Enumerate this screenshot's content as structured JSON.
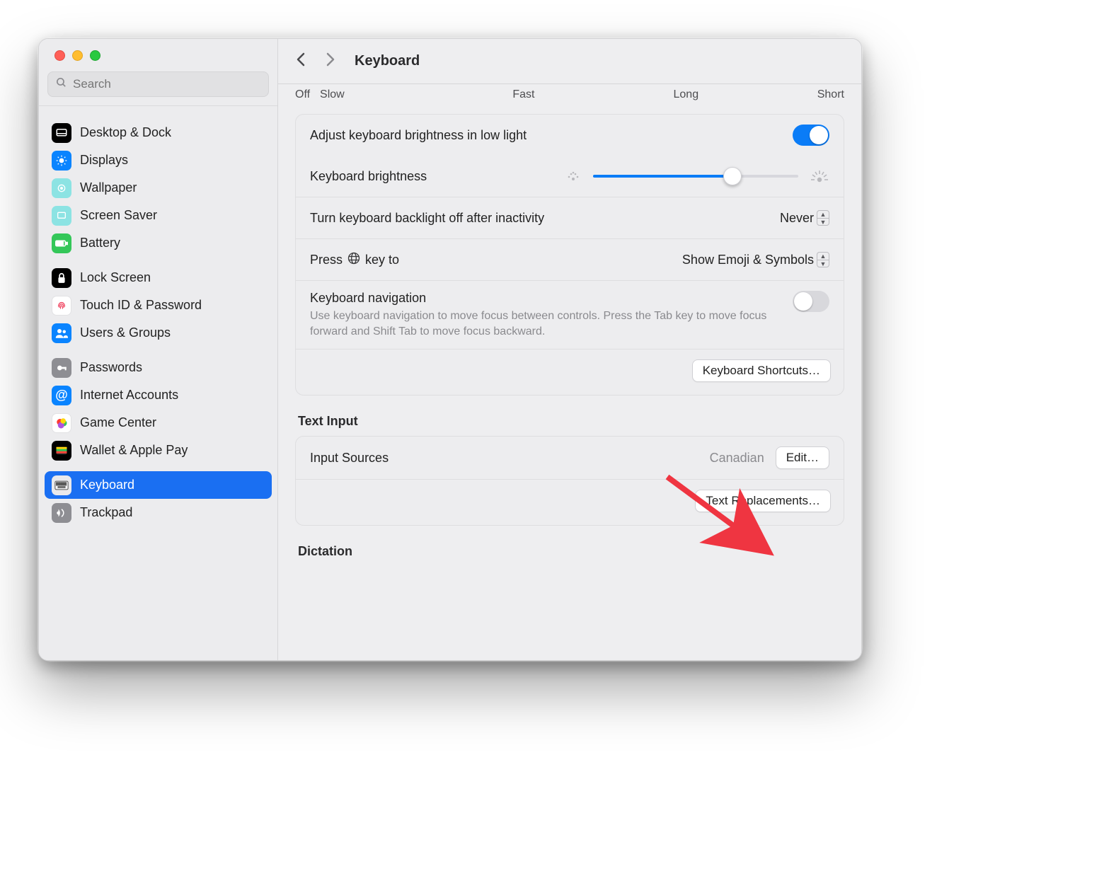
{
  "window_title": "Keyboard",
  "search": {
    "placeholder": "Search"
  },
  "sidebar": {
    "items": [
      {
        "id": "desktop-dock",
        "label": "Desktop & Dock"
      },
      {
        "id": "displays",
        "label": "Displays"
      },
      {
        "id": "wallpaper",
        "label": "Wallpaper"
      },
      {
        "id": "screen-saver",
        "label": "Screen Saver"
      },
      {
        "id": "battery",
        "label": "Battery"
      },
      {
        "id": "lock-screen",
        "label": "Lock Screen"
      },
      {
        "id": "touch-id",
        "label": "Touch ID & Password"
      },
      {
        "id": "users-groups",
        "label": "Users & Groups"
      },
      {
        "id": "passwords",
        "label": "Passwords"
      },
      {
        "id": "internet-accounts",
        "label": "Internet Accounts"
      },
      {
        "id": "game-center",
        "label": "Game Center"
      },
      {
        "id": "wallet",
        "label": "Wallet & Apple Pay"
      },
      {
        "id": "keyboard",
        "label": "Keyboard",
        "selected": true
      },
      {
        "id": "trackpad",
        "label": "Trackpad"
      }
    ]
  },
  "ticks": {
    "off": "Off",
    "slow": "Slow",
    "fast": "Fast",
    "long": "Long",
    "short": "Short"
  },
  "settings": {
    "adjust_low_light": {
      "label": "Adjust keyboard brightness in low light",
      "on": true
    },
    "brightness": {
      "label": "Keyboard brightness",
      "value_pct": 68
    },
    "backlight_off": {
      "label": "Turn keyboard backlight off after inactivity",
      "value": "Never"
    },
    "press_globe": {
      "label_prefix": "Press ",
      "label_suffix": " key to",
      "value": "Show Emoji & Symbols"
    },
    "kbd_nav": {
      "label": "Keyboard navigation",
      "desc": "Use keyboard navigation to move focus between controls. Press the Tab key to move focus forward and Shift Tab to move focus backward.",
      "on": false
    },
    "shortcuts_btn": "Keyboard Shortcuts…"
  },
  "text_input": {
    "heading": "Text Input",
    "input_sources_label": "Input Sources",
    "input_sources_value": "Canadian",
    "edit_btn": "Edit…",
    "text_replacements_btn": "Text Replacements…"
  },
  "dictation": {
    "heading": "Dictation"
  },
  "icons": {
    "desktop-dock": "#000000",
    "displays": "#0a84ff",
    "wallpaper": "#5ed1d1",
    "screen-saver": "#5ed1d1",
    "battery": "#34c759",
    "lock-screen": "#000000",
    "touch-id": "#ffffff",
    "users-groups": "#0a84ff",
    "passwords": "#8e8e93",
    "internet-accounts": "#0a84ff",
    "game-center": "#ffffff",
    "wallet": "#000000",
    "keyboard": "#e7e7ea",
    "trackpad": "#8e8e93"
  }
}
